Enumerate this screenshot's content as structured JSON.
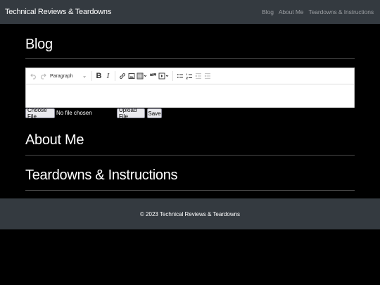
{
  "navbar": {
    "brand": "Technical Reviews & Teardowns",
    "links": [
      "Blog",
      "About Me",
      "Teardowns & Instructions"
    ]
  },
  "sections": {
    "blog": "Blog",
    "about": "About Me",
    "teardowns": "Teardowns & Instructions"
  },
  "editor": {
    "paragraph_format": "Paragraph",
    "toolbar_icons": [
      "undo-icon",
      "redo-icon",
      "bold-icon",
      "italic-icon",
      "link-icon",
      "image-icon",
      "table-icon",
      "blockquote-icon",
      "media-embed-icon",
      "bulleted-list-icon",
      "numbered-list-icon",
      "outdent-icon",
      "indent-icon"
    ],
    "bold_glyph": "B",
    "italic_glyph": "I",
    "quote_glyph": "❝❞"
  },
  "upload": {
    "choose_label": "Choose File",
    "no_file_text": "No file chosen",
    "upload_label": "Upload File",
    "save_label": "Save"
  },
  "footer": {
    "text": "© 2023 Technical Reviews & Teardowns"
  },
  "colors": {
    "navbar_bg": "#343a40",
    "page_bg": "#000000",
    "nav_link": "#9a9da1"
  }
}
